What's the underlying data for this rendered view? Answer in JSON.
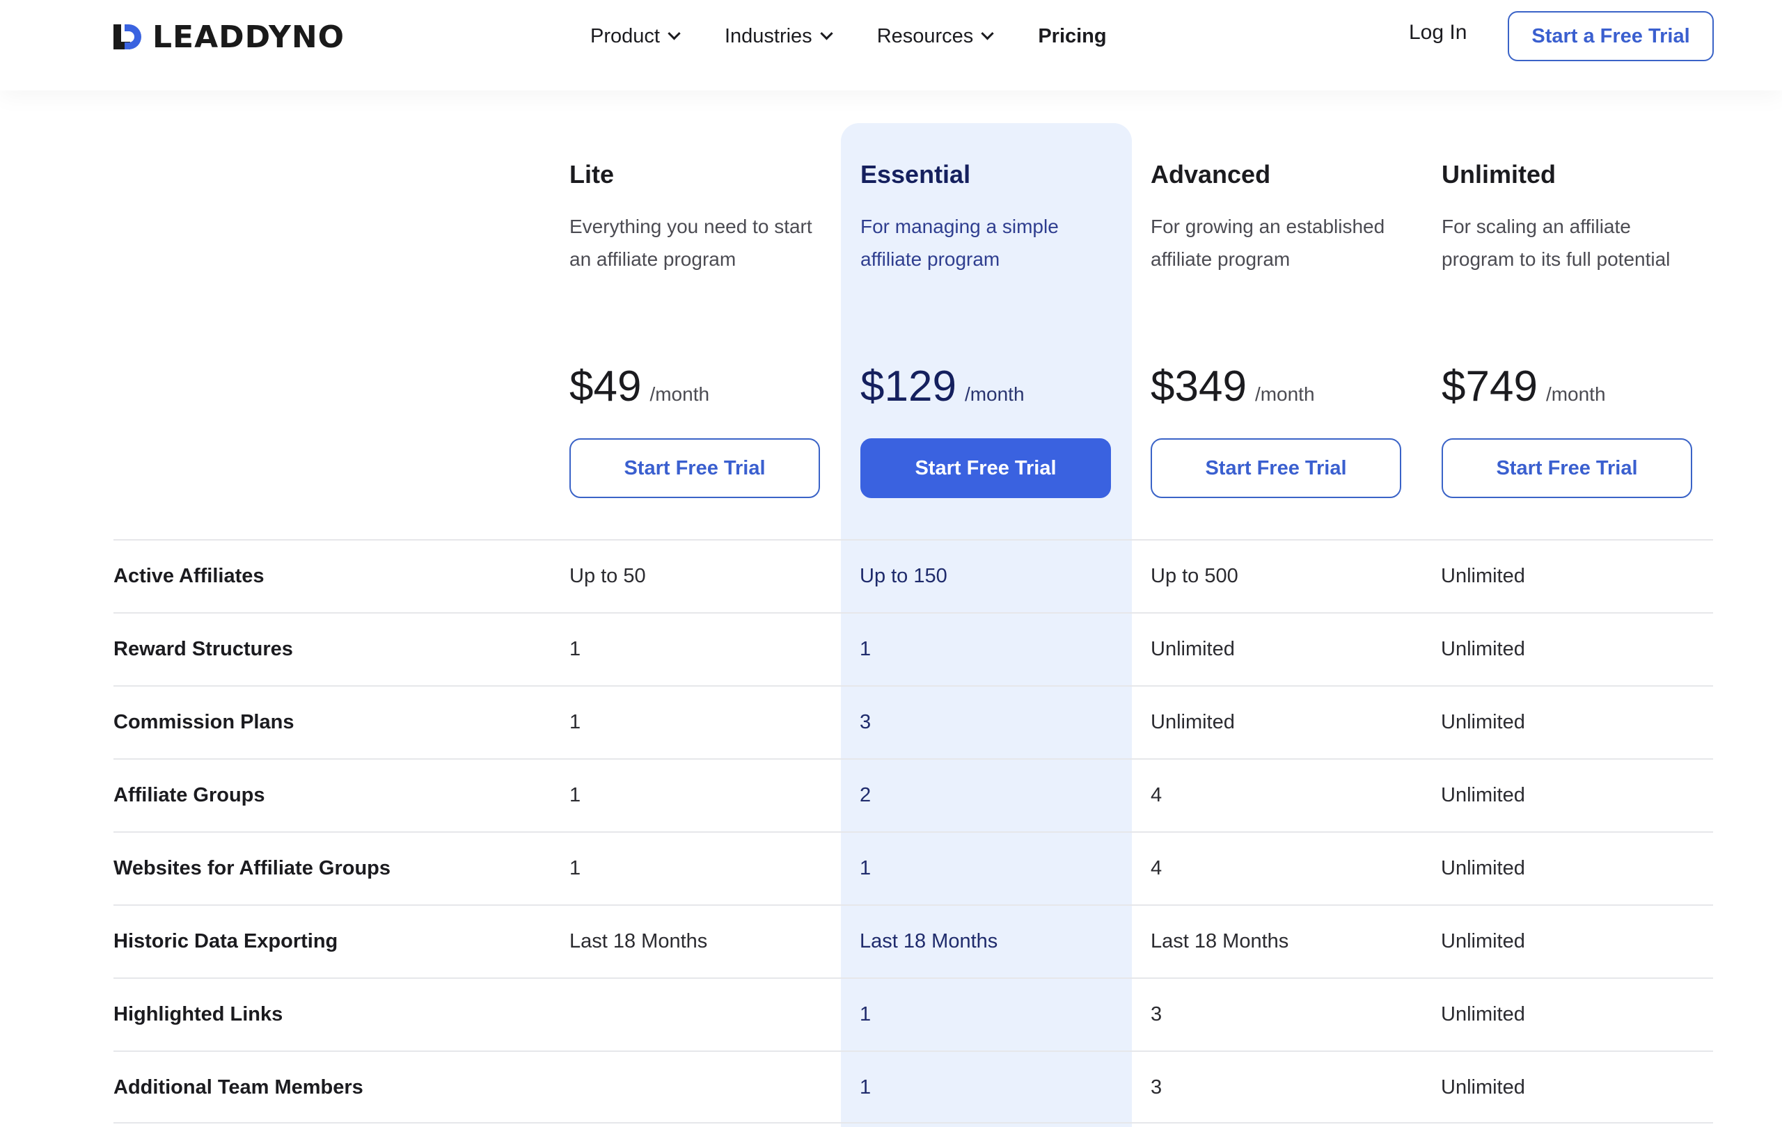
{
  "header": {
    "logo_text": "LEADDYNO",
    "nav": [
      {
        "label": "Product",
        "has_dropdown": true
      },
      {
        "label": "Industries",
        "has_dropdown": true
      },
      {
        "label": "Resources",
        "has_dropdown": true
      },
      {
        "label": "Pricing",
        "has_dropdown": false
      }
    ],
    "login_label": "Log In",
    "cta_label": "Start a Free Trial"
  },
  "colors": {
    "accent": "#3a62e0",
    "highlight_bg": "#eaf1fd",
    "featured_text": "#15205e"
  },
  "plans": [
    {
      "name": "Lite",
      "description": "Everything you need to start an affiliate program",
      "price": "$49",
      "period": "/month",
      "button": "Start Free Trial",
      "featured": false
    },
    {
      "name": "Essential",
      "description": "For managing a simple affiliate program",
      "price": "$129",
      "period": "/month",
      "button": "Start Free Trial",
      "featured": true
    },
    {
      "name": "Advanced",
      "description": "For growing an established affiliate program",
      "price": "$349",
      "period": "/month",
      "button": "Start Free Trial",
      "featured": false
    },
    {
      "name": "Unlimited",
      "description": "For scaling an affiliate program to its full potential",
      "price": "$749",
      "period": "/month",
      "button": "Start Free Trial",
      "featured": false
    }
  ],
  "features": [
    {
      "label": "Active Affiliates",
      "values": [
        "Up to 50",
        "Up to 150",
        "Up to 500",
        "Unlimited"
      ]
    },
    {
      "label": "Reward Structures",
      "values": [
        "1",
        "1",
        "Unlimited",
        "Unlimited"
      ]
    },
    {
      "label": "Commission Plans",
      "values": [
        "1",
        "3",
        "Unlimited",
        "Unlimited"
      ]
    },
    {
      "label": "Affiliate Groups",
      "values": [
        "1",
        "2",
        "4",
        "Unlimited"
      ]
    },
    {
      "label": "Websites for Affiliate Groups",
      "values": [
        "1",
        "1",
        "4",
        "Unlimited"
      ]
    },
    {
      "label": "Historic Data Exporting",
      "values": [
        "Last 18 Months",
        "Last 18 Months",
        "Last 18 Months",
        "Unlimited"
      ]
    },
    {
      "label": "Highlighted Links",
      "values": [
        "",
        "1",
        "3",
        "Unlimited"
      ]
    },
    {
      "label": "Additional Team Members",
      "values": [
        "",
        "1",
        "3",
        "Unlimited"
      ]
    }
  ]
}
